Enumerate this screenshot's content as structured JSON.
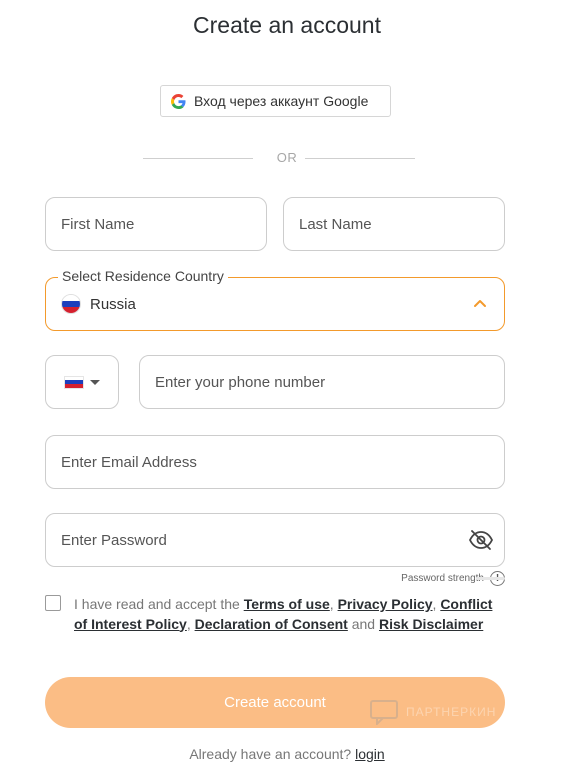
{
  "title": "Create an account",
  "google": {
    "label": "Вход через аккаунт Google"
  },
  "divider": {
    "or": "OR"
  },
  "fields": {
    "first_name": {
      "placeholder": "First Name"
    },
    "last_name": {
      "placeholder": "Last Name"
    },
    "country": {
      "legend": "Select Residence Country",
      "value": "Russia"
    },
    "phone": {
      "placeholder": "Enter your phone number"
    },
    "email": {
      "placeholder": "Enter Email Address"
    },
    "password": {
      "placeholder": "Enter Password"
    }
  },
  "password_strength": {
    "label": "Password strength",
    "level": 0
  },
  "consent": {
    "checked": false,
    "prefix": "I have read and accept the",
    "terms": "Terms of use",
    "privacy": "Privacy Policy",
    "conflict": "Conflict of Interest Policy",
    "declaration": "Declaration of Consent",
    "and": "and",
    "risk": "Risk Disclaimer"
  },
  "submit": {
    "label": "Create account"
  },
  "login": {
    "prompt": "Already have an account?",
    "link": "login"
  },
  "watermark": {
    "text": "ПАРТНЕРКИН"
  },
  "colors": {
    "accent": "#f39a2c",
    "button": "#fbbd85",
    "text": "#2b2f33"
  },
  "icons": [
    "google-icon",
    "russia-flag-icon",
    "chevron-up-icon",
    "caret-down-icon",
    "eye-off-icon",
    "info-icon"
  ]
}
